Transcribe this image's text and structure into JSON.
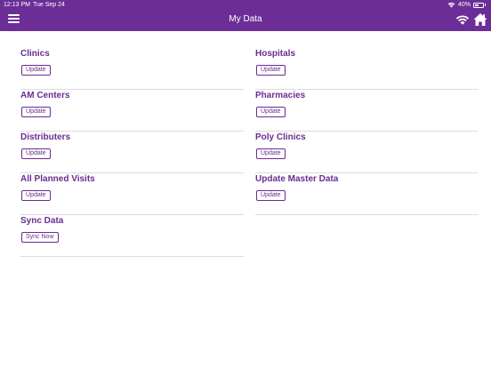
{
  "status_bar": {
    "time": "12:13 PM",
    "date": "Tue Sep 24",
    "battery": "40%"
  },
  "header": {
    "title": "My Data",
    "menu_icon": "hamburger-menu-icon",
    "wifi_icon": "wifi-icon",
    "home_icon": "home-icon",
    "background": "#6b2e97"
  },
  "items": [
    {
      "title": "Clinics",
      "button": "Update"
    },
    {
      "title": "Hospitals",
      "button": "Update"
    },
    {
      "title": "AM Centers",
      "button": "Update"
    },
    {
      "title": "Pharmacies",
      "button": "Update"
    },
    {
      "title": "Distributers",
      "button": "Update"
    },
    {
      "title": "Poly Clinics",
      "button": "Update"
    },
    {
      "title": "All Planned Visits",
      "button": "Update"
    },
    {
      "title": "Update Master Data",
      "button": "Update"
    },
    {
      "title": "Sync Data",
      "button": "Sync Now"
    }
  ],
  "colors": {
    "accent": "#6a2c91",
    "divider": "#dcdcdc"
  }
}
